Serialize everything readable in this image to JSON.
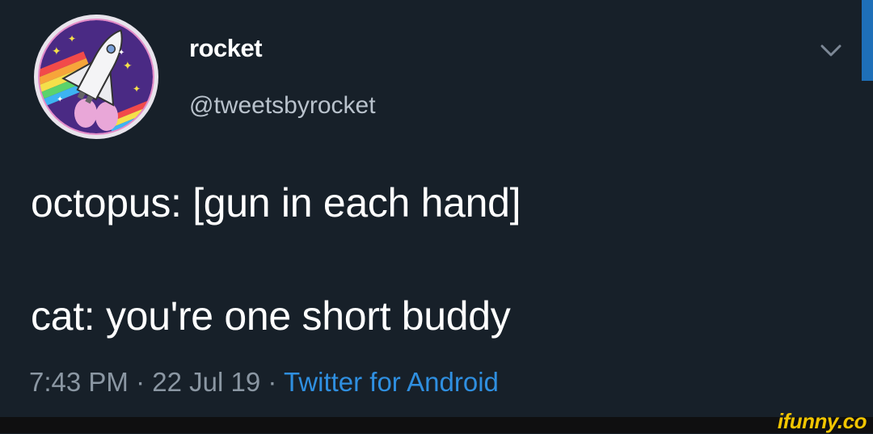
{
  "tweet": {
    "display_name": "rocket",
    "handle": "@tweetsbyrocket",
    "text_lines": [
      "octopus: [gun in each hand]",
      "cat: you're one short buddy"
    ],
    "time": "7:43 PM",
    "date": "22 Jul 19",
    "separator": "·",
    "source": "Twitter for Android",
    "avatar_icon": "rocket-shuttle-icon",
    "menu_icon": "chevron-down-icon"
  },
  "colors": {
    "background": "#172029",
    "text": "#ffffff",
    "handle": "#b9c2cc",
    "meta": "#8b97a3",
    "link": "#2f8fe0",
    "watermark": "#f2c500"
  },
  "watermark": {
    "text": "ifunny.co"
  }
}
